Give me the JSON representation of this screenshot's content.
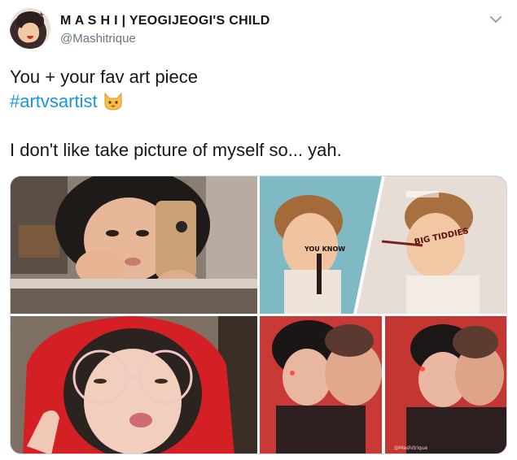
{
  "tweet": {
    "display_name": "M A S H I | YEOGIJEOGI'S CHILD",
    "handle": "@Mashitrique",
    "text_line1": "You + your fav art piece",
    "hashtag": "#artvsartist",
    "text_line3": "I don't like take picture of myself so... yah."
  },
  "art_labels": {
    "you_know": "YOU KNOW",
    "big_titties": "BIG TIDDIES",
    "watermark": "@Mashitrique"
  },
  "icons": {
    "menu": "chevron-down-icon",
    "emoji": "cat-face-emoji"
  },
  "colors": {
    "hashtag": "#1b95e0",
    "handle": "#657786",
    "border": "#ccd6dd"
  }
}
